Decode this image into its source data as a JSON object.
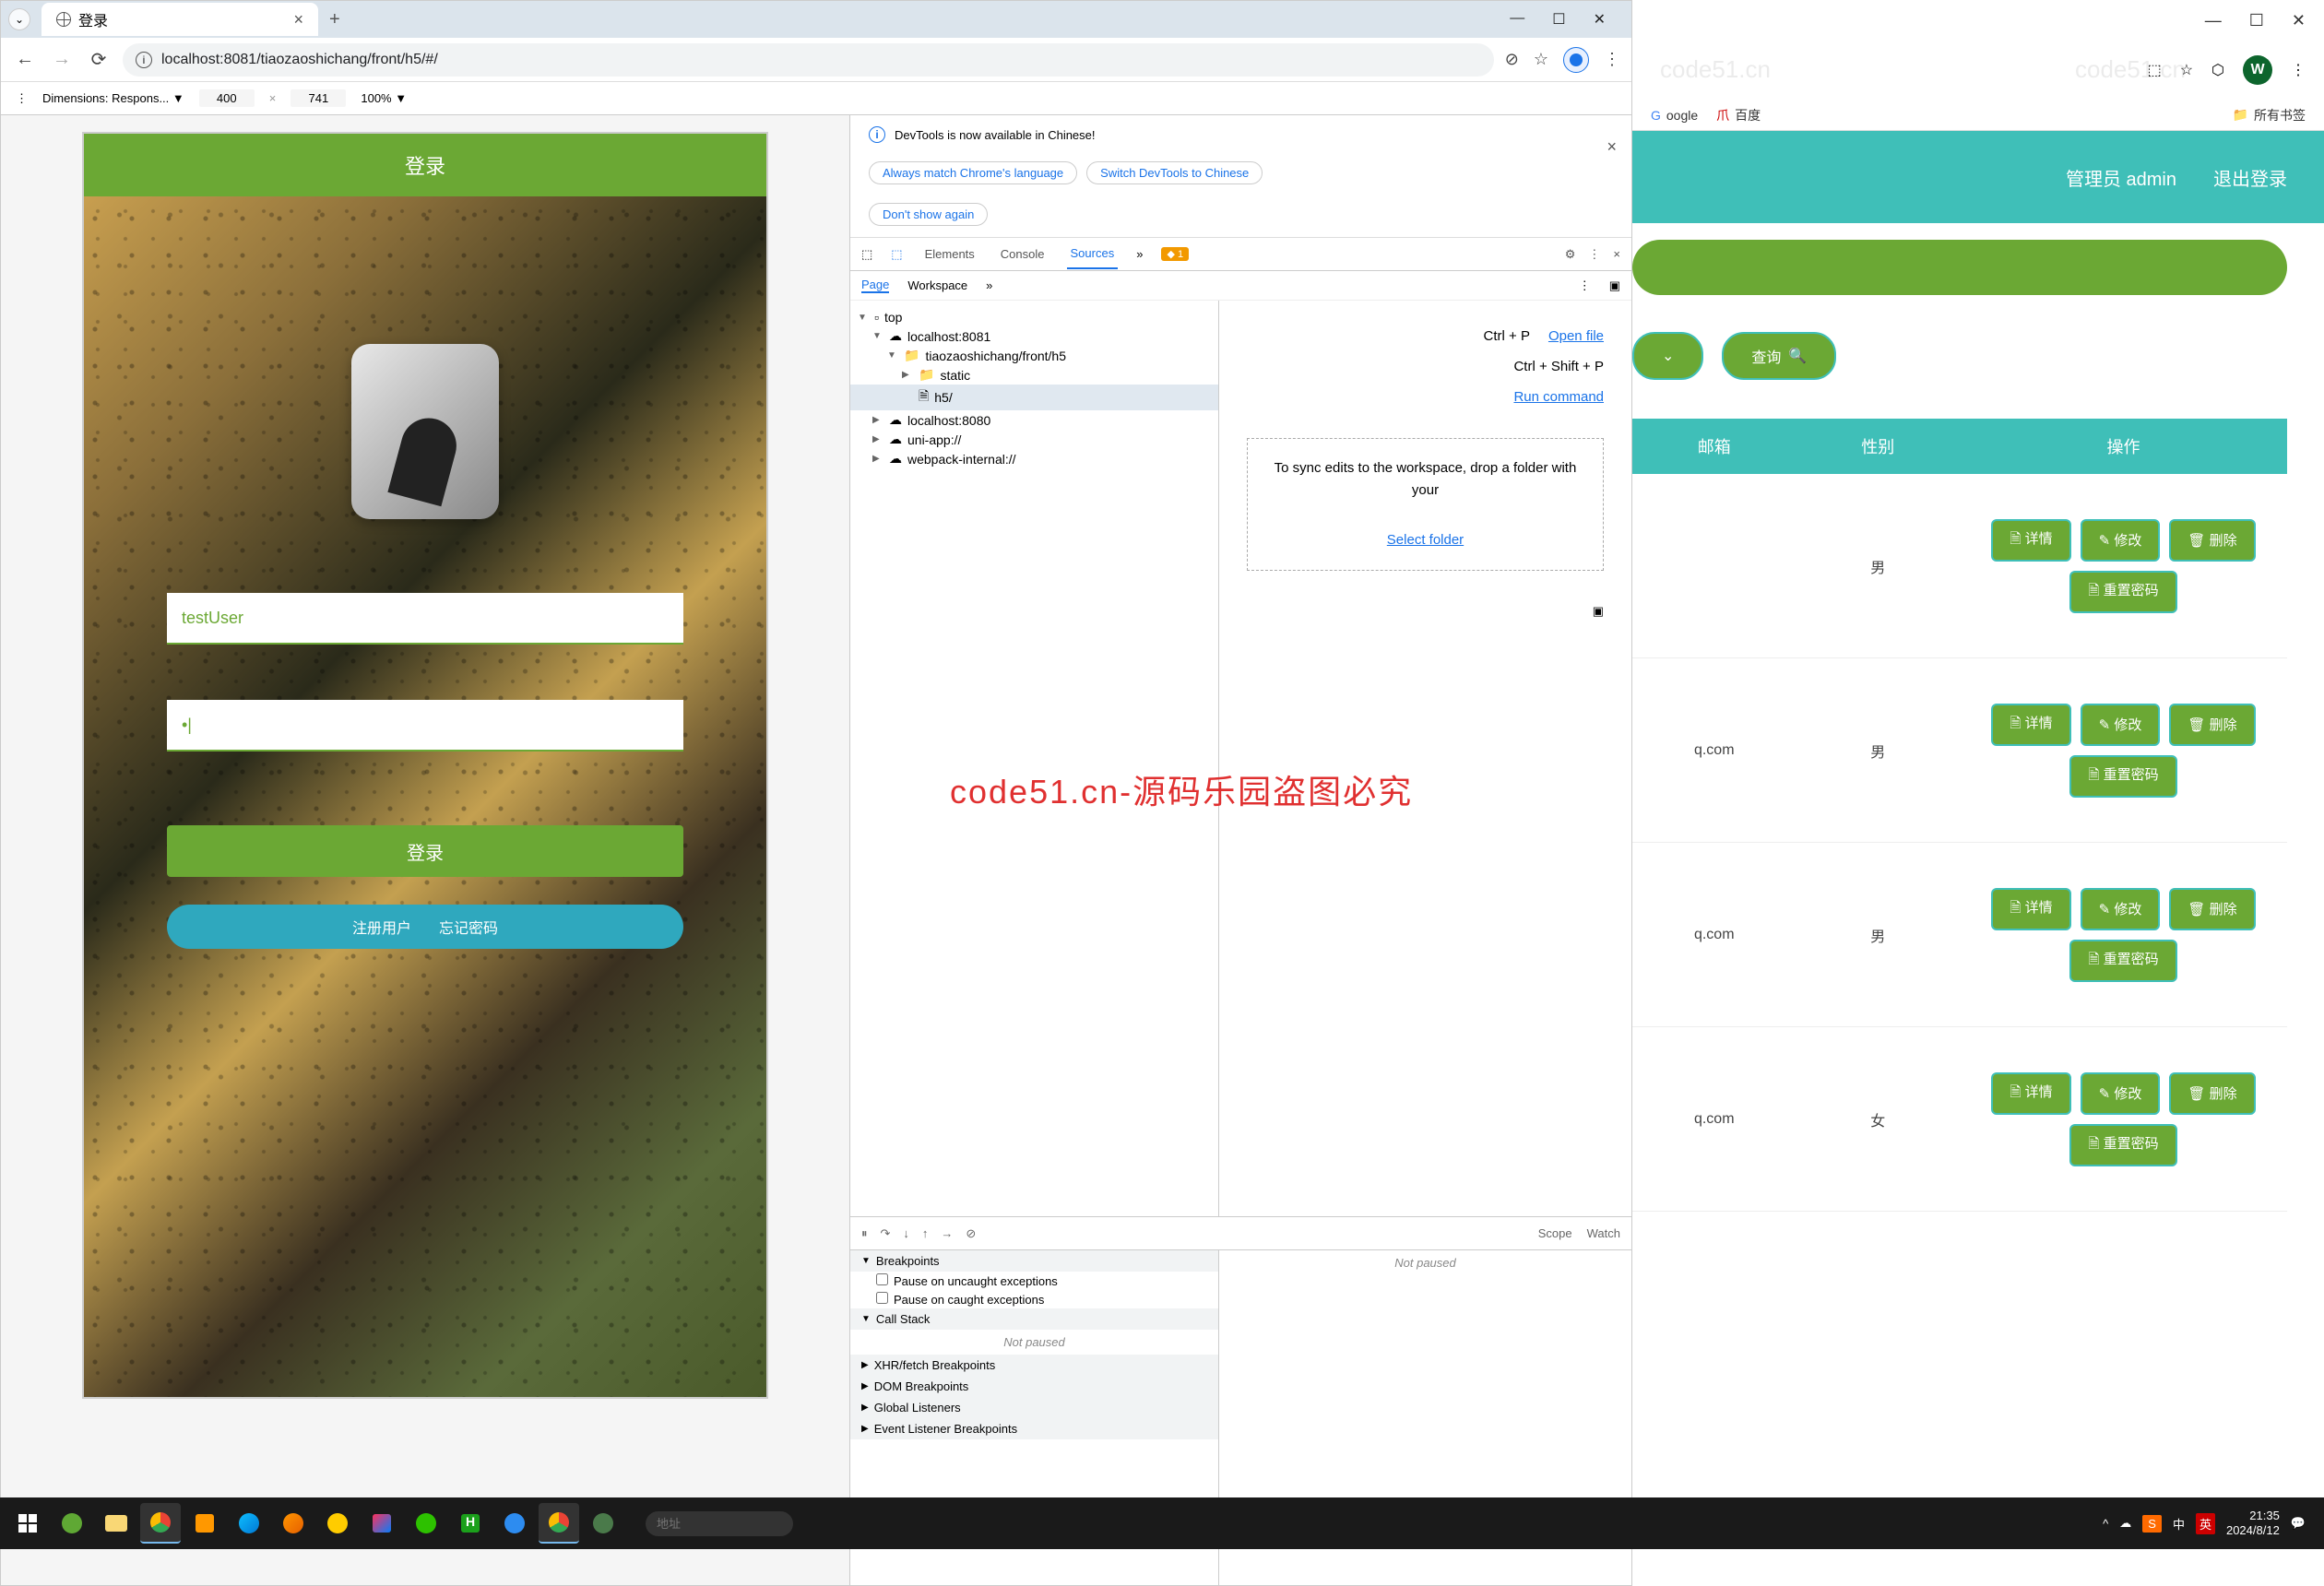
{
  "chrome": {
    "tab_title": "登录",
    "url": "localhost:8081/tiaozaoshichang/front/h5/#/",
    "win_min": "—",
    "win_max": "☐",
    "win_close": "✕"
  },
  "device_toolbar": {
    "dimensions_label": "Dimensions: Respons... ▼",
    "width": "400",
    "height": "741",
    "zoom": "100% ▼"
  },
  "login": {
    "header": "登录",
    "username_value": "testUser",
    "password_value": "•|",
    "submit": "登录",
    "register": "注册用户",
    "forgot": "忘记密码"
  },
  "devtools": {
    "banner_title": "DevTools is now available in Chinese!",
    "chip1": "Always match Chrome's language",
    "chip2": "Switch DevTools to Chinese",
    "chip3": "Don't show again",
    "tabs": {
      "elements": "Elements",
      "console": "Console",
      "sources": "Sources",
      "warn_count": "1"
    },
    "subtabs": {
      "page": "Page",
      "workspace": "Workspace"
    },
    "tree": {
      "top": "top",
      "host1": "localhost:8081",
      "folder": "tiaozaoshichang/front/h5",
      "static": "static",
      "h5": "h5/",
      "host2": "localhost:8080",
      "uniapp": "uni-app://",
      "webpack": "webpack-internal://"
    },
    "open_file_kbd": "Ctrl + P",
    "open_file": "Open file",
    "run_cmd_kbd": "Ctrl + Shift + P",
    "run_cmd": "Run command",
    "sync_msg": "To sync edits to the workspace, drop a folder with your",
    "select_folder": "Select folder",
    "breakpoints": "Breakpoints",
    "pause_uncaught": "Pause on uncaught exceptions",
    "pause_caught": "Pause on caught exceptions",
    "call_stack": "Call Stack",
    "not_paused": "Not paused",
    "xhr": "XHR/fetch Breakpoints",
    "dom": "DOM Breakpoints",
    "global": "Global Listeners",
    "event": "Event Listener Breakpoints",
    "scope": "Scope",
    "watch": "Watch"
  },
  "admin": {
    "bookmarks": {
      "google": "oogle",
      "baidu": "百度",
      "all": "所有书签"
    },
    "header_user": "管理员 admin",
    "logout": "退出登录",
    "query": "查询",
    "th_email": "邮箱",
    "th_gender": "性别",
    "th_action": "操作",
    "rows": [
      {
        "email": "",
        "gender": "男"
      },
      {
        "email": "q.com",
        "gender": "男"
      },
      {
        "email": "q.com",
        "gender": "男"
      },
      {
        "email": "q.com",
        "gender": "女"
      }
    ],
    "btn_detail": "详情",
    "btn_edit": "修改",
    "btn_delete": "删除",
    "btn_reset": "重置密码",
    "profile_letter": "W"
  },
  "overlay": "code51.cn-源码乐园盗图必究",
  "taskbar": {
    "search_placeholder": "地址",
    "ime_lang": "中",
    "ime_sub": "英",
    "time": "21:35",
    "date": "2024/8/12"
  },
  "watermark": "code51.cn"
}
